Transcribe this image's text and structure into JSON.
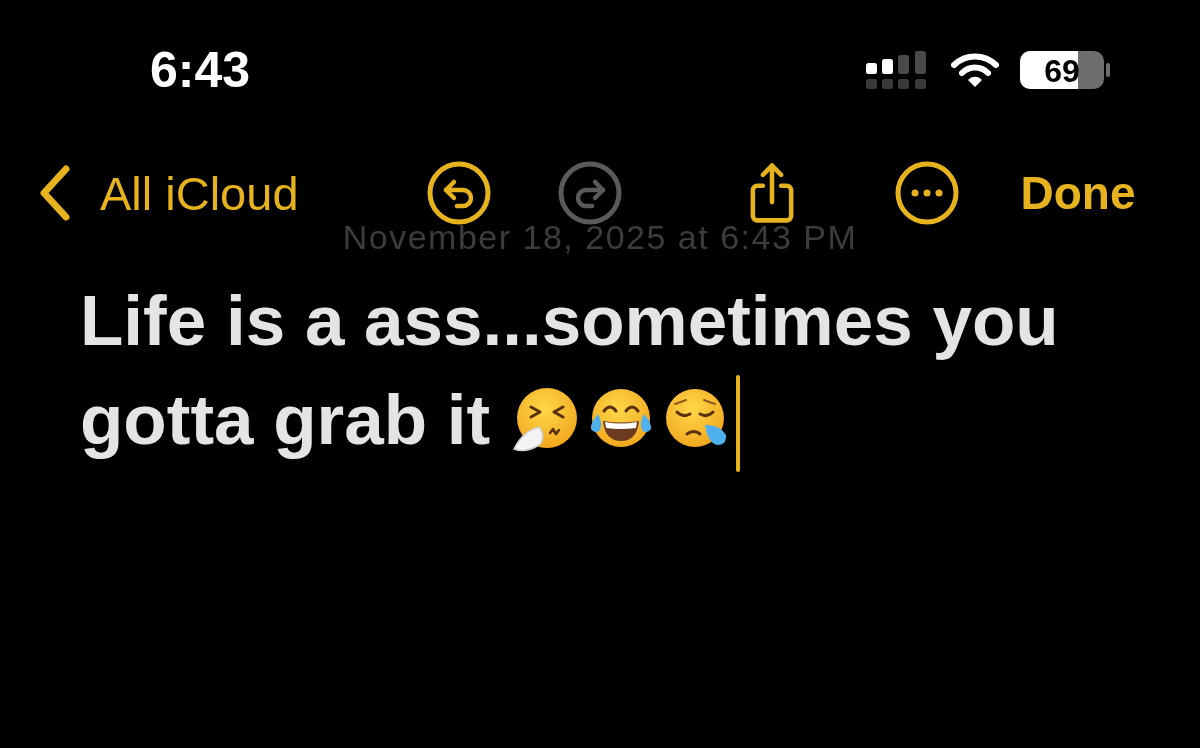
{
  "status_bar": {
    "time": "6:43",
    "battery_percent": "69"
  },
  "nav_bar": {
    "back_label": "All iCloud",
    "toolbar": [
      {
        "kind": "undo",
        "disabled": false
      },
      {
        "kind": "redo",
        "disabled": true
      },
      {
        "kind": "share",
        "disabled": false
      },
      {
        "kind": "more",
        "disabled": false
      }
    ],
    "done_label": "Done"
  },
  "note": {
    "date": "November 18, 2025 at 6:43 PM",
    "body_lines": [
      "Life is a ass...sometimes you",
      "gotta grab it"
    ]
  }
}
